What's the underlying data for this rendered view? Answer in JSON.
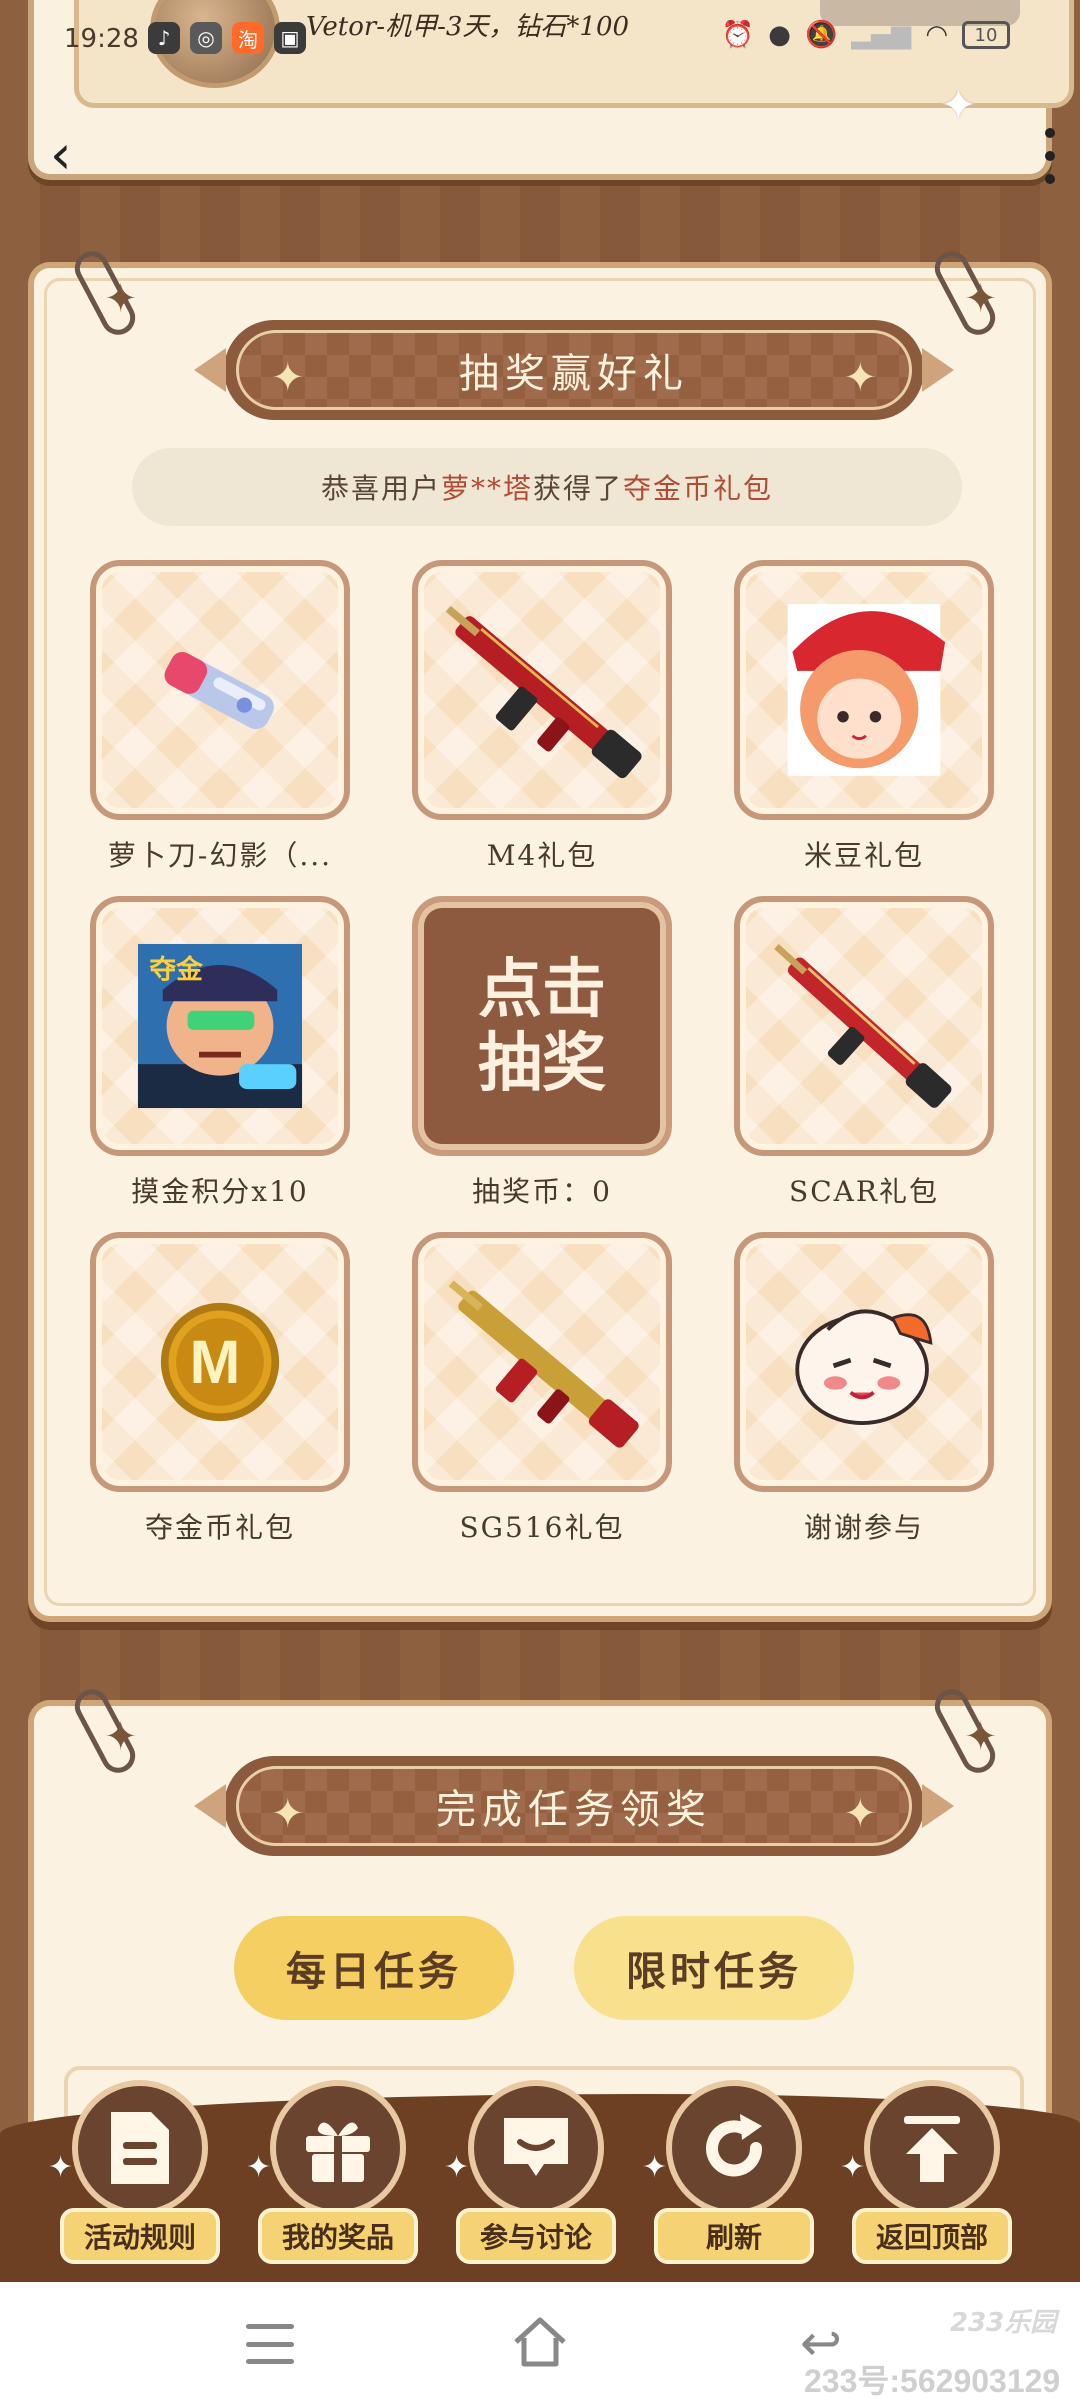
{
  "status_bar": {
    "time": "19:28",
    "notification_text": "Vetor-机甲-3天，钻石*100",
    "battery": "10"
  },
  "lottery": {
    "title": "抽奖赢好礼",
    "ticker": {
      "prefix": "恭喜用户",
      "user": "萝**塔",
      "middle": "获得了",
      "prize": "夺金币礼包"
    },
    "prizes": [
      {
        "label": "萝卜刀-幻影（...",
        "art": "knife-icon"
      },
      {
        "label": "M4礼包",
        "art": "rifle-icon"
      },
      {
        "label": "米豆礼包",
        "art": "character-icon"
      },
      {
        "label": "摸金积分x10",
        "art": "game-avatar-icon"
      },
      {
        "label": "抽奖币：0",
        "draw_text": "点击抽奖",
        "art": "draw-button"
      },
      {
        "label": "SCAR礼包",
        "art": "rifle-icon"
      },
      {
        "label": "夺金币礼包",
        "art": "coin-icon"
      },
      {
        "label": "SG516礼包",
        "art": "rifle-icon"
      },
      {
        "label": "谢谢参与",
        "art": "mascot-icon"
      }
    ]
  },
  "tasks": {
    "title": "完成任务领奖",
    "daily_label": "每日任务",
    "limited_label": "限时任务"
  },
  "float_menu": [
    {
      "label": "活动规则",
      "icon": "document-icon"
    },
    {
      "label": "我的奖品",
      "icon": "gift-icon"
    },
    {
      "label": "参与讨论",
      "icon": "chat-icon"
    },
    {
      "label": "刷新",
      "icon": "refresh-icon"
    },
    {
      "label": "返回顶部",
      "icon": "back-to-top-icon"
    }
  ],
  "watermark": {
    "logo": "233乐园",
    "id": "233号:562903129"
  },
  "colors": {
    "background": "#8a5e3c",
    "card": "#fbf2e2",
    "banner": "#8c5a3c",
    "daily_button": "#f6cf63",
    "limited_button": "#f9e08d",
    "float_label": "#f5d274"
  }
}
